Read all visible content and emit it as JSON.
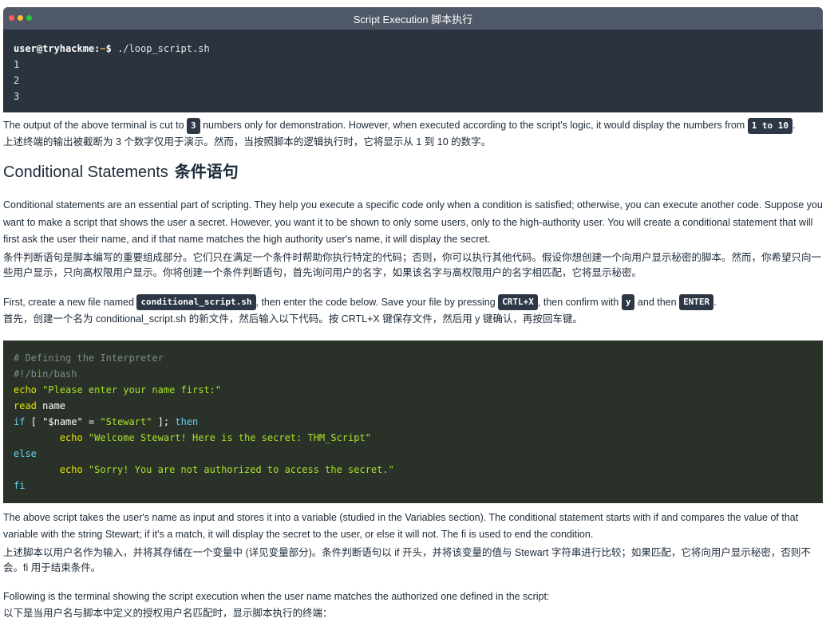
{
  "terminal1": {
    "title": "Script Execution  脚本执行",
    "prompt_user": "user@tryhackme:",
    "prompt_tilde": "~",
    "prompt_dollar": "$",
    "command": " ./loop_script.sh",
    "output": [
      "1",
      "2",
      "3"
    ],
    "dot_colors": [
      "#ff5f56",
      "#ffbd2e",
      "#27c93f"
    ]
  },
  "para1": {
    "text_a": "The output of the above terminal is cut to ",
    "chip_a": "3",
    "text_b": " numbers only for demonstration. However, when executed according to the script's logic, it would display the numbers from ",
    "chip_b": "1 to 10",
    "text_c": ".",
    "zh": "上述终端的输出被截断为 3 个数字仅用于演示。然而，当按照脚本的逻辑执行时，它将显示从 1 到 10 的数字。"
  },
  "section": {
    "title": "Conditional Statements",
    "title_zh": "条件语句"
  },
  "para2": {
    "text": "Conditional statements are an essential part of scripting. They help you execute a specific code only when a condition is satisfied; otherwise, you can execute another code. Suppose you want to make a script that shows the user a secret. However, you want it to be shown to only some users, only to the high-authority user. You will create a conditional statement that will first ask the user their name, and if that name matches the high authority user's name, it will display the secret.",
    "zh": "条件判断语句是脚本编写的重要组成部分。它们只在满足一个条件时帮助你执行特定的代码；否则，你可以执行其他代码。假设你想创建一个向用户显示秘密的脚本。然而，你希望只向一些用户显示，只向高权限用户显示。你将创建一个条件判断语句，首先询问用户的名字，如果该名字与高权限用户的名字相匹配，它将显示秘密。"
  },
  "para3": {
    "text_a": "First, create a new file named ",
    "chip_a": "conditional_script.sh",
    "text_b": ", then enter the code below. Save your file by pressing ",
    "chip_b": "CRTL+X",
    "text_c": ", then confirm with ",
    "chip_c": "y",
    "text_d": " and then ",
    "chip_d": "ENTER",
    "text_e": ".",
    "zh": "首先，创建一个名为 conditional_script.sh 的新文件，然后输入以下代码。按 CRTL+X 键保存文件，然后用 y 键确认，再按回车键。"
  },
  "code": {
    "l1": "# Defining the Interpreter",
    "l2": "#!/bin/bash",
    "l3_kw": "echo",
    "l3_str": " \"Please enter your name first:\"",
    "l4_kw": "read",
    "l4_rest": " name",
    "l5_kw": "if",
    "l5_a": " [ ",
    "l5_b": "\"$name\"",
    "l5_c": " = ",
    "l5_d": "\"Stewart\"",
    "l5_e": " ]; ",
    "l5_then": "then",
    "l6_indent": "        ",
    "l6_kw": "echo",
    "l6_str": " \"Welcome Stewart! Here is the secret: THM_Script\"",
    "l7_kw": "else",
    "l8_indent": "        ",
    "l8_kw": "echo",
    "l8_str": " \"Sorry! You are not authorized to access the secret.\"",
    "l9_kw": "fi"
  },
  "para4": {
    "text": "The above script takes the user's name as input and stores it into a variable (studied in the Variables section). The conditional statement starts with if and compares the value of that variable with the string Stewart; if it's a match, it will display the secret to the user, or else it will not. The fi is used to end the condition.",
    "zh": "上述脚本以用户名作为输入，并将其存储在一个变量中 (详见变量部分)。条件判断语句以 if 开头，并将该变量的值与 Stewart 字符串进行比较；如果匹配，它将向用户显示秘密，否则不会。fi 用于结束条件。"
  },
  "para5": {
    "text": "Following is the terminal showing the script execution when the user name matches the authorized one defined in the script:",
    "zh": "以下是当用户名与脚本中定义的授权用户名匹配时，显示脚本执行的终端："
  }
}
